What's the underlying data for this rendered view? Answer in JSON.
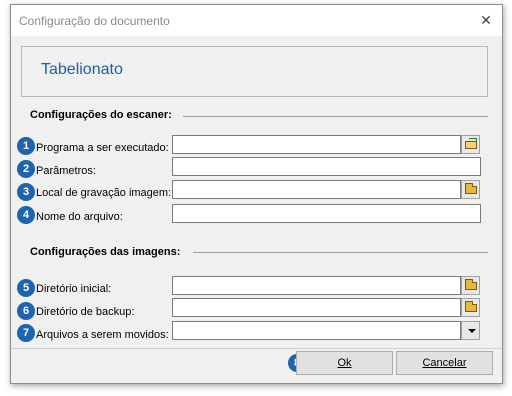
{
  "window": {
    "title": "Configuração do documento",
    "close_glyph": "✕"
  },
  "header": {
    "title": "Tabelionato"
  },
  "sections": {
    "scanner": "Configurações do escaner:",
    "images": "Configurações das imagens:"
  },
  "badges": [
    "1",
    "2",
    "3",
    "4",
    "5",
    "6",
    "7",
    "8"
  ],
  "fields": {
    "program": {
      "label": "Programa a ser executado:",
      "value": "",
      "icon": "open-folder-icon"
    },
    "params": {
      "label": "Parâmetros:",
      "value": ""
    },
    "save_location": {
      "label": "Local de gravação imagem:",
      "value": "",
      "icon": "folder-icon"
    },
    "file_name": {
      "label": "Nome do arquivo:",
      "value": ""
    },
    "initial_dir": {
      "label": "Diretório inicial:",
      "value": "",
      "icon": "folder-icon"
    },
    "backup_dir": {
      "label": "Diretório de backup:",
      "value": "",
      "icon": "folder-icon"
    },
    "files_to_move": {
      "label": "Arquivos a serem movidos:",
      "value": "",
      "icon": "dropdown-arrow-icon"
    }
  },
  "buttons": {
    "ok": {
      "label": "Ok"
    },
    "cancel": {
      "label": "Cancelar"
    }
  },
  "colors": {
    "accent": "#1f64ad",
    "header_title": "#1f5fa8"
  }
}
